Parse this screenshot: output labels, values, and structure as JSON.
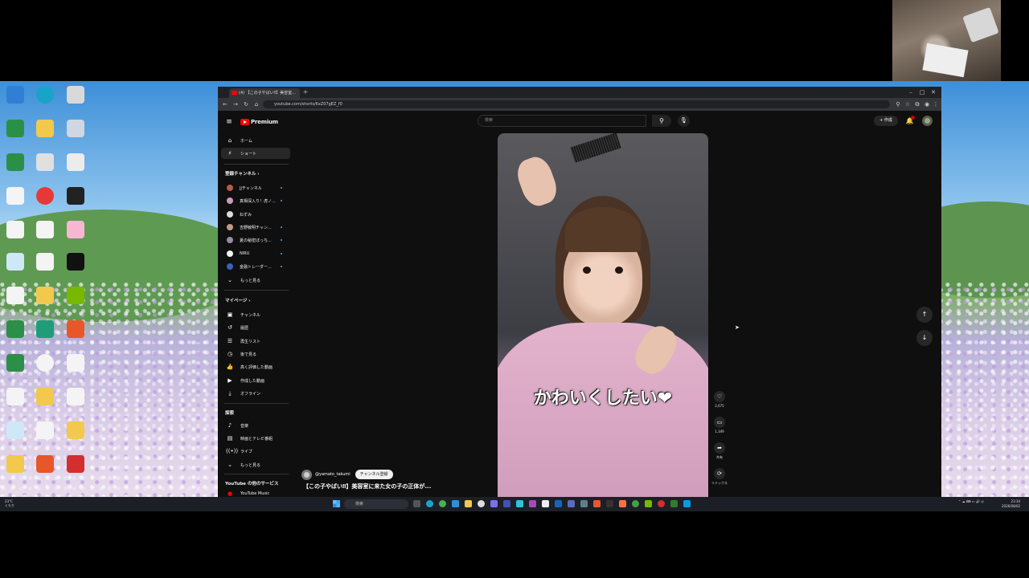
{
  "browser": {
    "tab_title": "(4) 【この子やばい‼】美容室...",
    "new_tab": "+",
    "url": "youtube.com/shorts/6xZ07gEZ_f0"
  },
  "youtube": {
    "logo_text": "Premium",
    "search_placeholder": "検索",
    "create_label": "作成",
    "sidebar": {
      "home": "ホーム",
      "shorts": "ショート",
      "subscriptions_heading": "登録チャンネル",
      "channels": [
        {
          "name": "JJチャンネル",
          "color": "#b35b4b"
        },
        {
          "name": "真相深入り！虎ノ...",
          "color": "#c7a0b5"
        },
        {
          "name": "ねずみ",
          "color": "#dcdcdc"
        },
        {
          "name": "吉野敏明チャン...",
          "color": "#c49b86"
        },
        {
          "name": "夏の秘密ぼっち...",
          "color": "#9a8aa6"
        },
        {
          "name": "NIRU",
          "color": "#f2f2f2"
        },
        {
          "name": "金融トレーダー...",
          "color": "#3a62b5"
        }
      ],
      "show_more_1": "もっと見る",
      "mypage_heading": "マイページ",
      "mypage": [
        "チャンネル",
        "履歴",
        "再生リスト",
        "後で見る",
        "高く評価した動画",
        "作成した動画",
        "オフライン"
      ],
      "explore_heading": "探索",
      "explore": [
        "音楽",
        "映画とテレビ番組",
        "ライブ"
      ],
      "show_more_2": "もっと見る",
      "other_heading": "YouTube の他のサービス",
      "other_first": "YouTube Music"
    },
    "short": {
      "caption": "かわいくしたい❤",
      "channel": "@yamato_takumi",
      "subscribe_label": "チャンネル登録",
      "title": "【この子やばい‼】美容室に来た女の子の正体が...",
      "likes": "2,675",
      "comments": "1,349",
      "share_label": "共有",
      "remix_label": "リミックス"
    }
  },
  "taskbar": {
    "weather_temp": "23°C",
    "weather_desc": "くもり",
    "search_placeholder": "検索",
    "time": "23:34",
    "date": "2026/08/02"
  }
}
